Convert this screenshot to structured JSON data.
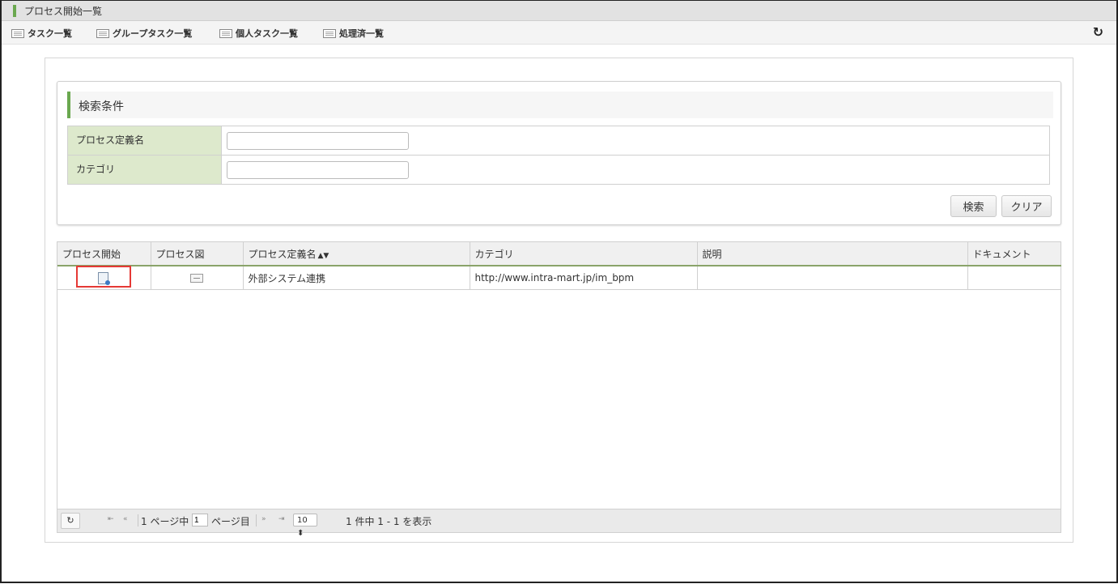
{
  "window": {
    "title": "プロセス開始一覧"
  },
  "toolbar": {
    "items": [
      "タスク一覧",
      "グループタスク一覧",
      "個人タスク一覧",
      "処理済一覧"
    ],
    "refresh_icon": "↻"
  },
  "search": {
    "heading": "検索条件",
    "fields": [
      {
        "label": "プロセス定義名",
        "value": "",
        "placeholder": ""
      },
      {
        "label": "カテゴリ",
        "value": "",
        "placeholder": ""
      }
    ],
    "search_button": "検索",
    "clear_button": "クリア"
  },
  "grid": {
    "columns": [
      "プロセス開始",
      "プロセス図",
      "プロセス定義名",
      "カテゴリ",
      "説明",
      "ドキュメント"
    ],
    "sort_indicator": "▲▼",
    "rows": [
      {
        "name": "外部システム連携",
        "category": "http://www.intra-mart.jp/im_bpm",
        "description": "",
        "document": ""
      }
    ]
  },
  "pager": {
    "reload_icon": "↻",
    "first": "⇤",
    "prev": "«",
    "page_prefix": "1 ページ中",
    "page_value": "1",
    "page_suffix": "ページ目",
    "next": "»",
    "last": "⇥",
    "per_page": "10 ⬍",
    "summary": "1 件中 1 - 1 を表示"
  },
  "colors": {
    "accent": "#6aa84f",
    "label_bg": "#dde9cc",
    "highlight": "#e53935"
  }
}
